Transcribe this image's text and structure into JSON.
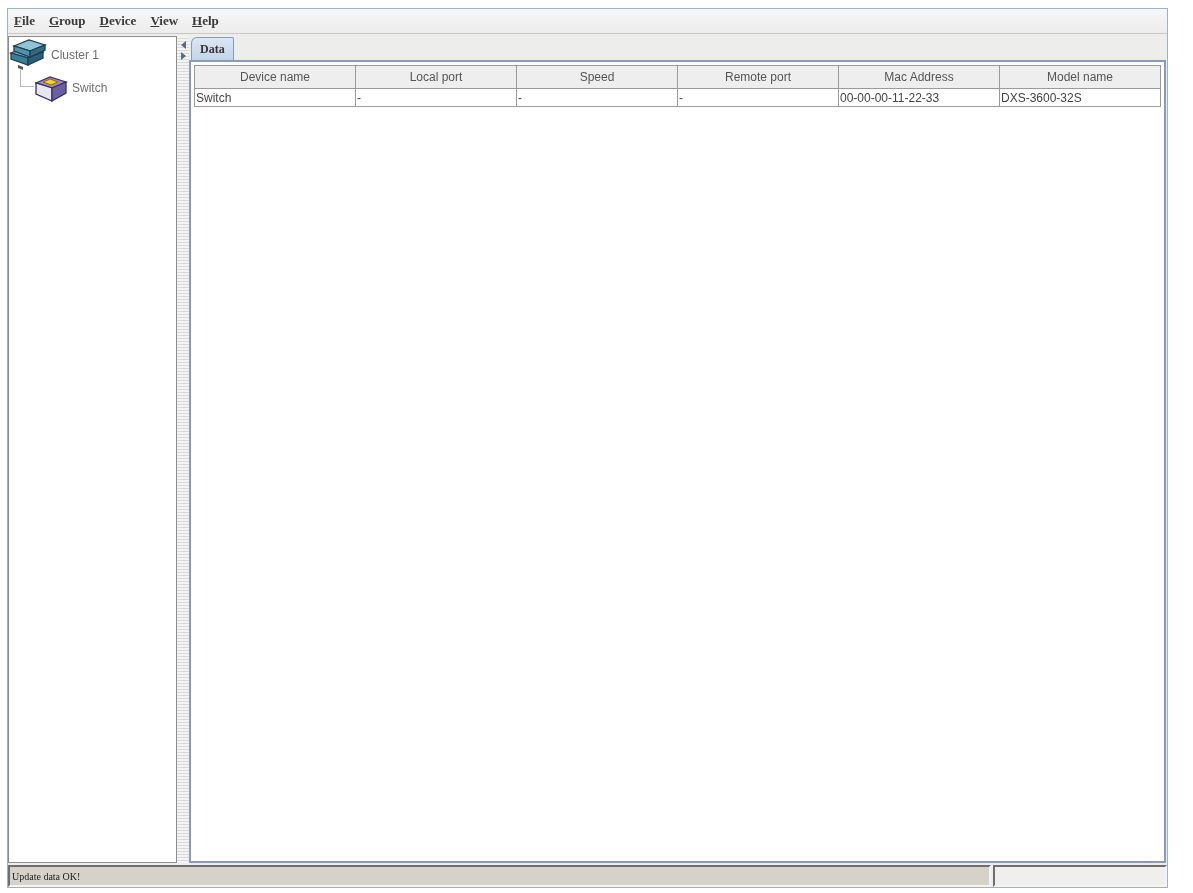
{
  "menu": [
    {
      "label": "File"
    },
    {
      "label": "Group"
    },
    {
      "label": "Device"
    },
    {
      "label": "View"
    },
    {
      "label": "Help"
    }
  ],
  "tree": [
    {
      "label": "Cluster 1",
      "kind": "cluster",
      "children": [
        {
          "label": "Switch",
          "kind": "switch"
        }
      ]
    }
  ],
  "tabs": [
    {
      "label": "Data",
      "selected": true
    }
  ],
  "table": {
    "columns": [
      "Device name",
      "Local port",
      "Speed",
      "Remote port",
      "Mac Address",
      "Model name"
    ],
    "rows": [
      [
        "Switch",
        "-",
        "-",
        "-",
        "00-00-00-11-22-33",
        "DXS-3600-32S"
      ]
    ]
  },
  "status_bar": {
    "message": "Update data OK!"
  }
}
